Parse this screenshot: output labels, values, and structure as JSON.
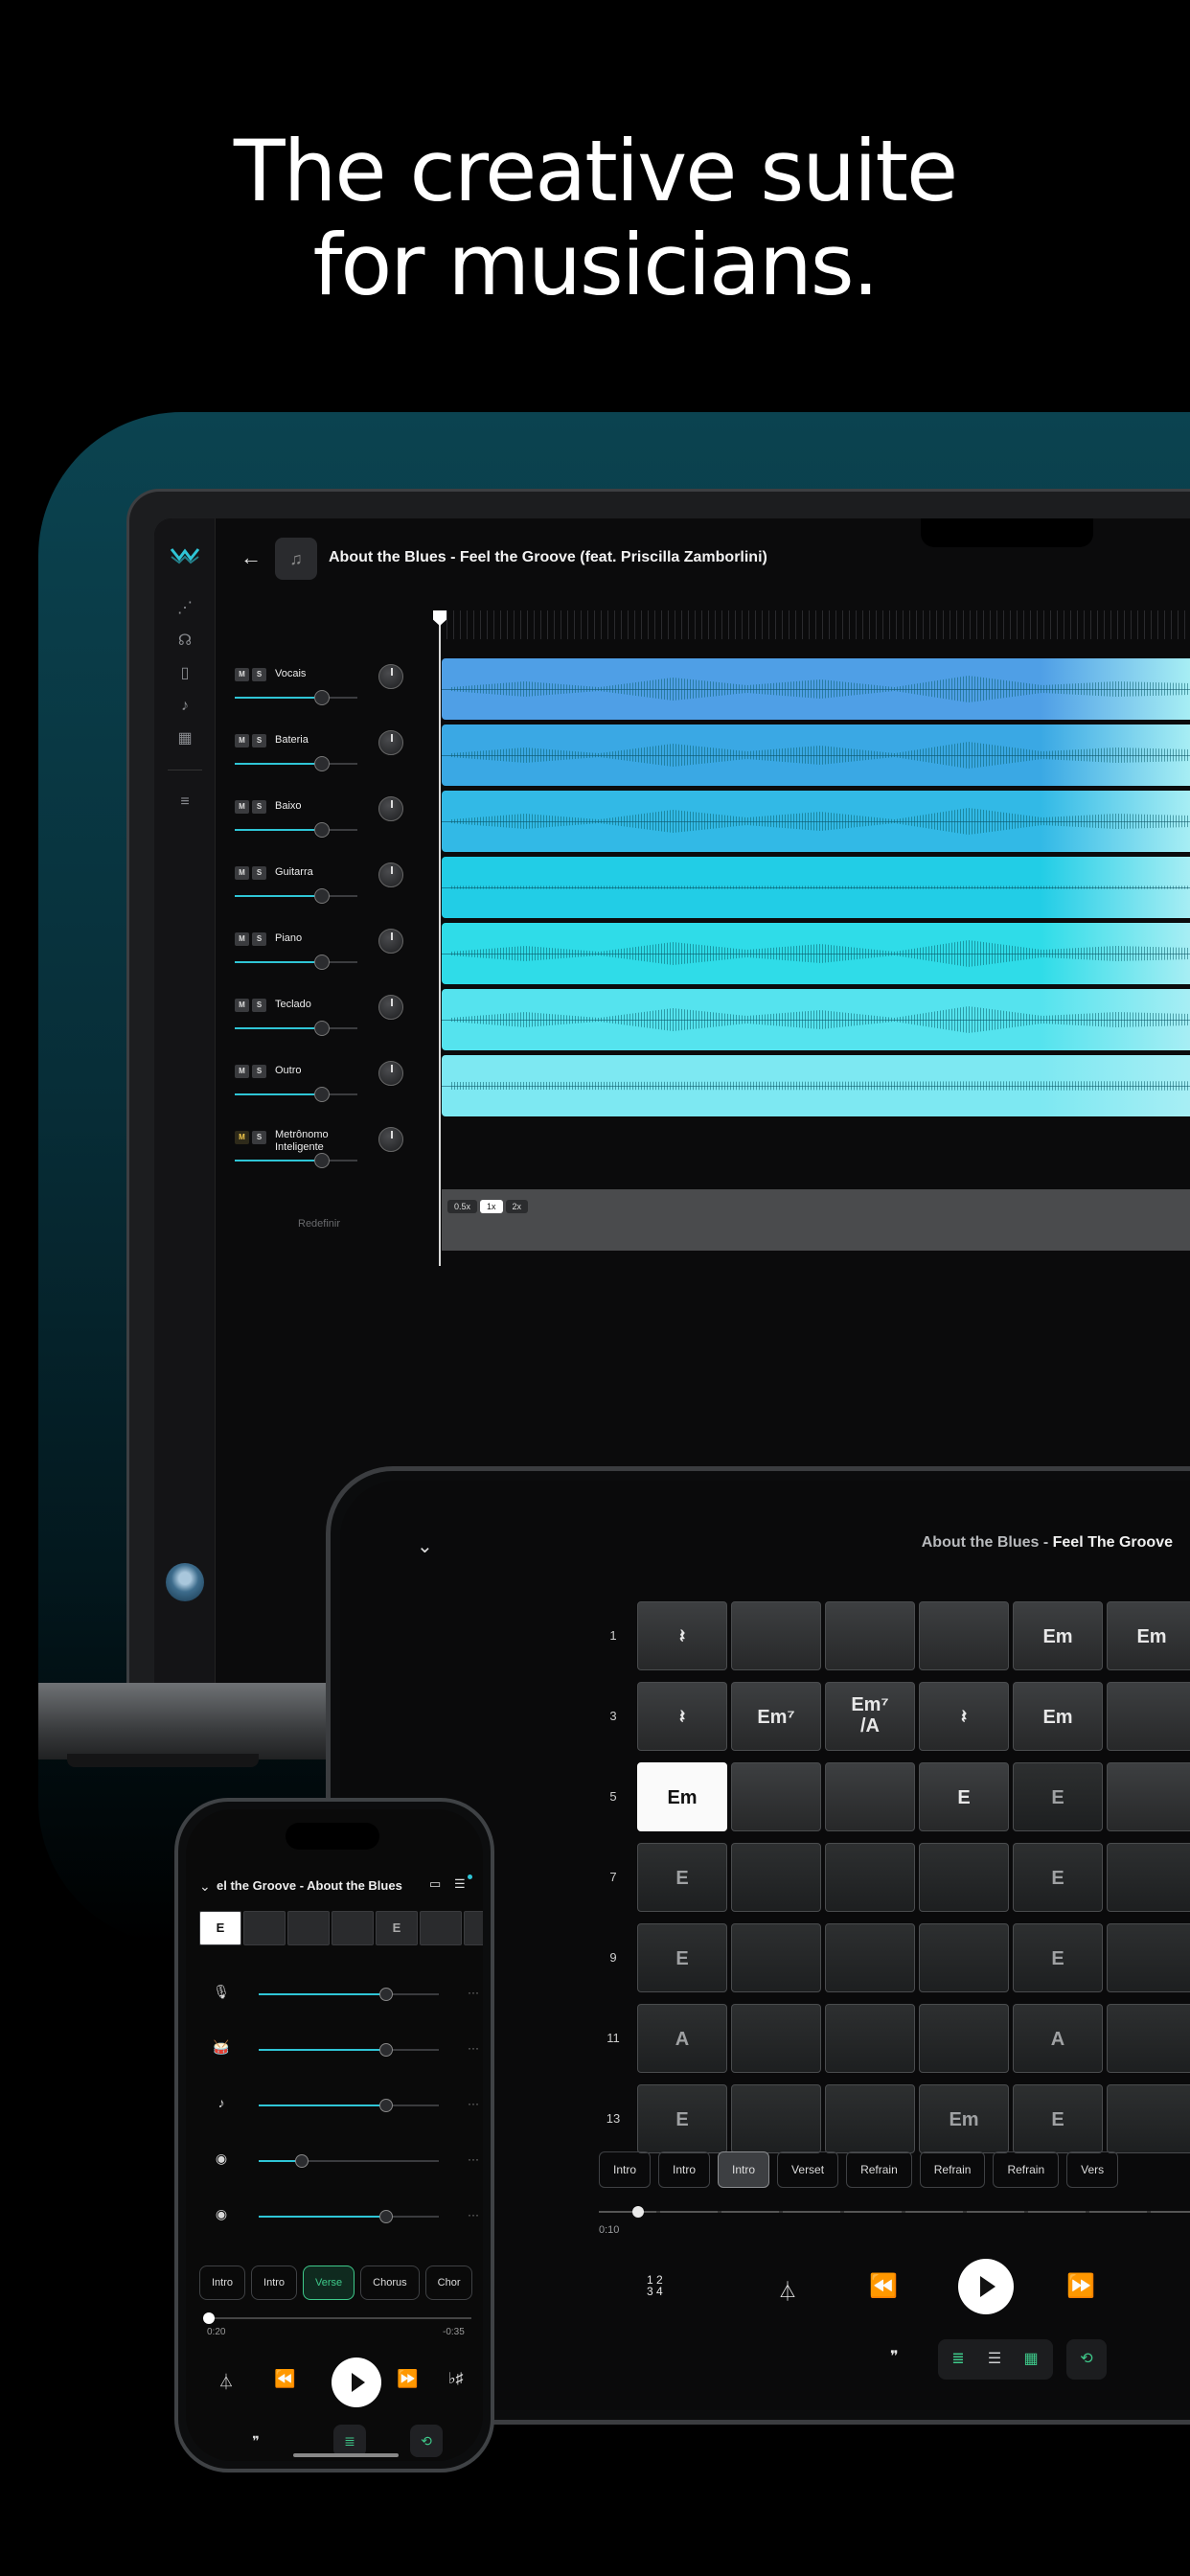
{
  "headline": {
    "line1": "The creative suite",
    "line2": "for musicians."
  },
  "desktop": {
    "song_title": "About the Blues - Feel the Groove (feat. Priscilla Zamborlini)",
    "mute_label": "M",
    "solo_label": "S",
    "tracks": [
      {
        "name": "Vocais",
        "volume": 0.71
      },
      {
        "name": "Bateria",
        "volume": 0.71
      },
      {
        "name": "Baixo",
        "volume": 0.71
      },
      {
        "name": "Guitarra",
        "volume": 0.71
      },
      {
        "name": "Piano",
        "volume": 0.71
      },
      {
        "name": "Teclado",
        "volume": 0.71
      },
      {
        "name": "Outro",
        "volume": 0.71
      },
      {
        "name": "Metrônomo Inteligente",
        "volume": 0.71
      }
    ],
    "reset_label": "Redefinir",
    "speed_options": [
      "0.5x",
      "1x",
      "2x"
    ],
    "speed_selected": "1x",
    "lane_colors": [
      "#4f9fe6",
      "#3aa8e4",
      "#32b9e6",
      "#22cde6",
      "#2fdce8",
      "#55e3ee",
      "#7de8f2"
    ]
  },
  "tablet": {
    "title_bold": "About the Blues - ",
    "title_rest": "Feel The Groove",
    "row_numbers": [
      "1",
      "3",
      "5",
      "7",
      "9",
      "11",
      "13"
    ],
    "grid": [
      [
        "𝄽",
        "",
        "",
        "",
        "Em",
        "Em"
      ],
      [
        "𝄽",
        "Em⁷",
        "Em⁷/A",
        "𝄽",
        "Em",
        ""
      ],
      [
        "Em",
        "",
        "",
        "E",
        "E",
        ""
      ],
      [
        "E",
        "",
        "",
        "",
        "E",
        ""
      ],
      [
        "E",
        "",
        "",
        "",
        "E",
        ""
      ],
      [
        "A",
        "",
        "",
        "",
        "A",
        ""
      ],
      [
        "E",
        "",
        "",
        "Em",
        "E",
        ""
      ]
    ],
    "sections": [
      "Intro",
      "Intro",
      "Intro",
      "Verset",
      "Refrain",
      "Refrain",
      "Refrain",
      "Vers"
    ],
    "active_section": 2,
    "time": "0:10",
    "progress": 0.04,
    "time_signature": "1 2\n3 4"
  },
  "phone": {
    "title": "el the Groove - About the Blues",
    "chord_strip": [
      "E",
      "",
      "",
      "",
      "E",
      "",
      ""
    ],
    "mixer_rows": [
      {
        "icon": "microphone-icon",
        "volume": 0.71
      },
      {
        "icon": "drum-icon",
        "volume": 0.71
      },
      {
        "icon": "guitar-icon",
        "volume": 0.71
      },
      {
        "icon": "guitar-amp-1-icon",
        "volume": 0.24
      },
      {
        "icon": "guitar-amp-2-icon",
        "volume": 0.71
      }
    ],
    "sections": [
      "Intro",
      "Intro",
      "Verse",
      "Chorus",
      "Chor"
    ],
    "active_section": 2,
    "time_elapsed": "0:20",
    "time_remaining": "-0:35",
    "progress": 0.0
  }
}
